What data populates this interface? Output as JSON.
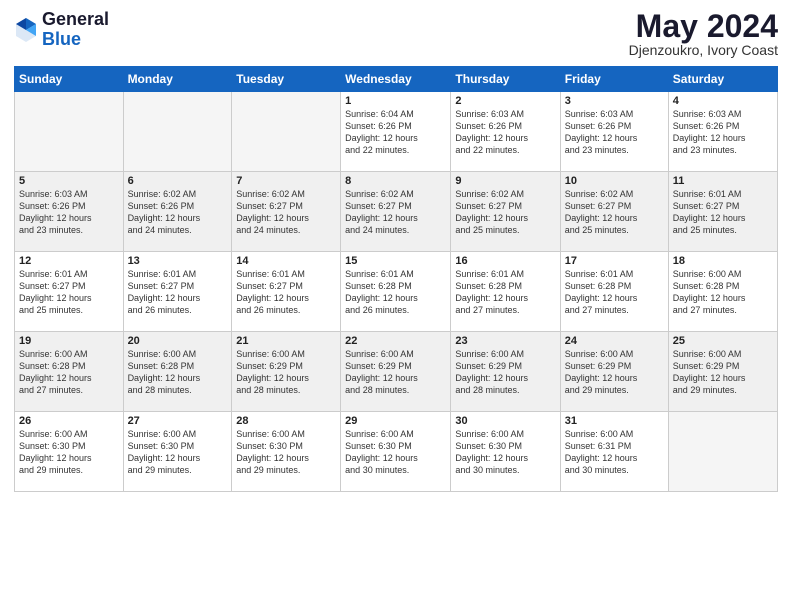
{
  "header": {
    "logo_general": "General",
    "logo_blue": "Blue",
    "month_title": "May 2024",
    "location": "Djenzoukro, Ivory Coast"
  },
  "weekdays": [
    "Sunday",
    "Monday",
    "Tuesday",
    "Wednesday",
    "Thursday",
    "Friday",
    "Saturday"
  ],
  "weeks": [
    [
      {
        "num": "",
        "info": "",
        "empty": true
      },
      {
        "num": "",
        "info": "",
        "empty": true
      },
      {
        "num": "",
        "info": "",
        "empty": true
      },
      {
        "num": "1",
        "info": "Sunrise: 6:04 AM\nSunset: 6:26 PM\nDaylight: 12 hours\nand 22 minutes."
      },
      {
        "num": "2",
        "info": "Sunrise: 6:03 AM\nSunset: 6:26 PM\nDaylight: 12 hours\nand 22 minutes."
      },
      {
        "num": "3",
        "info": "Sunrise: 6:03 AM\nSunset: 6:26 PM\nDaylight: 12 hours\nand 23 minutes."
      },
      {
        "num": "4",
        "info": "Sunrise: 6:03 AM\nSunset: 6:26 PM\nDaylight: 12 hours\nand 23 minutes."
      }
    ],
    [
      {
        "num": "5",
        "info": "Sunrise: 6:03 AM\nSunset: 6:26 PM\nDaylight: 12 hours\nand 23 minutes.",
        "shaded": true
      },
      {
        "num": "6",
        "info": "Sunrise: 6:02 AM\nSunset: 6:26 PM\nDaylight: 12 hours\nand 24 minutes.",
        "shaded": true
      },
      {
        "num": "7",
        "info": "Sunrise: 6:02 AM\nSunset: 6:27 PM\nDaylight: 12 hours\nand 24 minutes.",
        "shaded": true
      },
      {
        "num": "8",
        "info": "Sunrise: 6:02 AM\nSunset: 6:27 PM\nDaylight: 12 hours\nand 24 minutes.",
        "shaded": true
      },
      {
        "num": "9",
        "info": "Sunrise: 6:02 AM\nSunset: 6:27 PM\nDaylight: 12 hours\nand 25 minutes.",
        "shaded": true
      },
      {
        "num": "10",
        "info": "Sunrise: 6:02 AM\nSunset: 6:27 PM\nDaylight: 12 hours\nand 25 minutes.",
        "shaded": true
      },
      {
        "num": "11",
        "info": "Sunrise: 6:01 AM\nSunset: 6:27 PM\nDaylight: 12 hours\nand 25 minutes.",
        "shaded": true
      }
    ],
    [
      {
        "num": "12",
        "info": "Sunrise: 6:01 AM\nSunset: 6:27 PM\nDaylight: 12 hours\nand 25 minutes."
      },
      {
        "num": "13",
        "info": "Sunrise: 6:01 AM\nSunset: 6:27 PM\nDaylight: 12 hours\nand 26 minutes."
      },
      {
        "num": "14",
        "info": "Sunrise: 6:01 AM\nSunset: 6:27 PM\nDaylight: 12 hours\nand 26 minutes."
      },
      {
        "num": "15",
        "info": "Sunrise: 6:01 AM\nSunset: 6:28 PM\nDaylight: 12 hours\nand 26 minutes."
      },
      {
        "num": "16",
        "info": "Sunrise: 6:01 AM\nSunset: 6:28 PM\nDaylight: 12 hours\nand 27 minutes."
      },
      {
        "num": "17",
        "info": "Sunrise: 6:01 AM\nSunset: 6:28 PM\nDaylight: 12 hours\nand 27 minutes."
      },
      {
        "num": "18",
        "info": "Sunrise: 6:00 AM\nSunset: 6:28 PM\nDaylight: 12 hours\nand 27 minutes."
      }
    ],
    [
      {
        "num": "19",
        "info": "Sunrise: 6:00 AM\nSunset: 6:28 PM\nDaylight: 12 hours\nand 27 minutes.",
        "shaded": true
      },
      {
        "num": "20",
        "info": "Sunrise: 6:00 AM\nSunset: 6:28 PM\nDaylight: 12 hours\nand 28 minutes.",
        "shaded": true
      },
      {
        "num": "21",
        "info": "Sunrise: 6:00 AM\nSunset: 6:29 PM\nDaylight: 12 hours\nand 28 minutes.",
        "shaded": true
      },
      {
        "num": "22",
        "info": "Sunrise: 6:00 AM\nSunset: 6:29 PM\nDaylight: 12 hours\nand 28 minutes.",
        "shaded": true
      },
      {
        "num": "23",
        "info": "Sunrise: 6:00 AM\nSunset: 6:29 PM\nDaylight: 12 hours\nand 28 minutes.",
        "shaded": true
      },
      {
        "num": "24",
        "info": "Sunrise: 6:00 AM\nSunset: 6:29 PM\nDaylight: 12 hours\nand 29 minutes.",
        "shaded": true
      },
      {
        "num": "25",
        "info": "Sunrise: 6:00 AM\nSunset: 6:29 PM\nDaylight: 12 hours\nand 29 minutes.",
        "shaded": true
      }
    ],
    [
      {
        "num": "26",
        "info": "Sunrise: 6:00 AM\nSunset: 6:30 PM\nDaylight: 12 hours\nand 29 minutes."
      },
      {
        "num": "27",
        "info": "Sunrise: 6:00 AM\nSunset: 6:30 PM\nDaylight: 12 hours\nand 29 minutes."
      },
      {
        "num": "28",
        "info": "Sunrise: 6:00 AM\nSunset: 6:30 PM\nDaylight: 12 hours\nand 29 minutes."
      },
      {
        "num": "29",
        "info": "Sunrise: 6:00 AM\nSunset: 6:30 PM\nDaylight: 12 hours\nand 30 minutes."
      },
      {
        "num": "30",
        "info": "Sunrise: 6:00 AM\nSunset: 6:30 PM\nDaylight: 12 hours\nand 30 minutes."
      },
      {
        "num": "31",
        "info": "Sunrise: 6:00 AM\nSunset: 6:31 PM\nDaylight: 12 hours\nand 30 minutes."
      },
      {
        "num": "",
        "info": "",
        "empty": true
      }
    ]
  ]
}
